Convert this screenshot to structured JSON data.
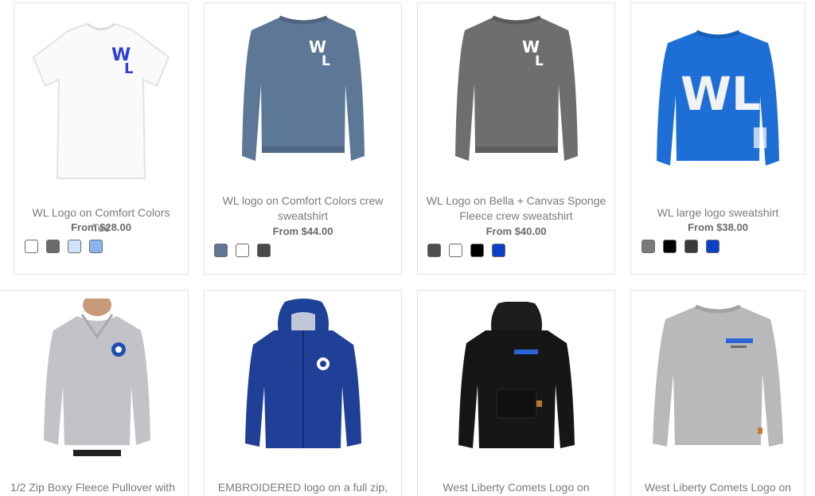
{
  "products": [
    {
      "title": "WL Logo on Comfort Colors Tee",
      "price": "From $28.00",
      "image_icon": "white-tshirt-icon",
      "swatches": [
        "#ffffff",
        "#6b6b6b",
        "#cfe3fb",
        "#8ab4f0"
      ]
    },
    {
      "title": "WL logo on Comfort Colors crew sweatshirt",
      "price": "From $44.00",
      "image_icon": "blue-gray-sweatshirt-icon",
      "swatches": [
        "#5f7894",
        "#ffffff",
        "#4a4a4a"
      ]
    },
    {
      "title": "WL Logo on Bella + Canvas Sponge Fleece crew sweatshirt",
      "price": "From $40.00",
      "image_icon": "gray-sweatshirt-icon",
      "swatches": [
        "#4e4e4e",
        "#ffffff",
        "#000000",
        "#0a3fc7"
      ]
    },
    {
      "title": "WL large logo sweatshirt",
      "price": "From $38.00",
      "image_icon": "blue-sweatshirt-icon",
      "swatches": [
        "#7a7a7a",
        "#000000",
        "#3a3a3a",
        "#0a3fc7"
      ]
    },
    {
      "title": "1/2 Zip Boxy Fleece Pullover with",
      "image_icon": "gray-half-zip-pullover-icon"
    },
    {
      "title": "EMBROIDERED logo on a full zip,",
      "image_icon": "navy-zip-jacket-icon"
    },
    {
      "title": "West Liberty Comets Logo on",
      "image_icon": "black-hoodie-icon"
    },
    {
      "title": "West Liberty Comets Logo on",
      "image_icon": "gray-crewneck-icon"
    }
  ]
}
